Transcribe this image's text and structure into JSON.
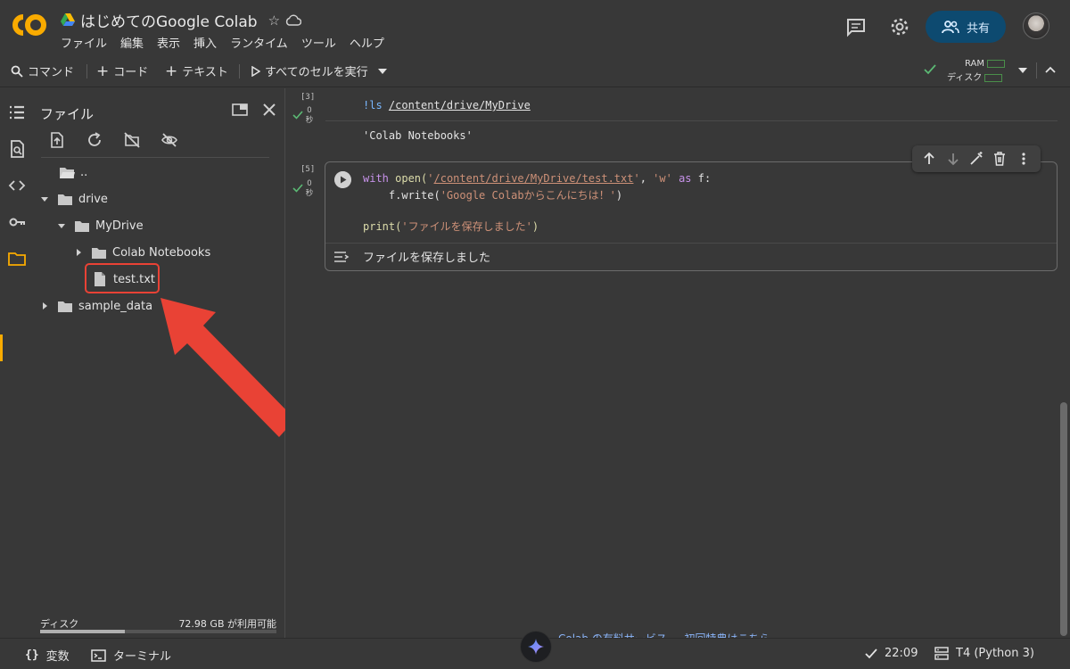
{
  "header": {
    "title": "はじめてのGoogle Colab",
    "menu": [
      "ファイル",
      "編集",
      "表示",
      "挿入",
      "ランタイム",
      "ツール",
      "ヘルプ"
    ],
    "share_label": "共有"
  },
  "toolbar": {
    "command": "コマンド",
    "add_code": "コード",
    "add_text": "テキスト",
    "run_all": "すべてのセルを実行",
    "ram_label": "RAM",
    "disk_label": "ディスク"
  },
  "file_panel": {
    "title": "ファイル",
    "tree": [
      {
        "label": "..",
        "type": "parent"
      },
      {
        "label": "drive",
        "type": "folder",
        "expanded": true
      },
      {
        "label": "MyDrive",
        "type": "folder",
        "expanded": true
      },
      {
        "label": "Colab Notebooks",
        "type": "folder",
        "expanded": false
      },
      {
        "label": "test.txt",
        "type": "file",
        "highlighted": true
      },
      {
        "label": "sample_data",
        "type": "folder",
        "expanded": false
      }
    ],
    "disk_label": "ディスク",
    "disk_free": "72.98 GB が利用可能",
    "disk_usage_fraction": 0.36
  },
  "cells": [
    {
      "exec_count": "[3]",
      "time_value": "0",
      "time_unit": "秒",
      "code_bang": "!ls ",
      "code_path": "/content/drive/MyDrive",
      "output": "'Colab Notebooks'"
    },
    {
      "exec_count": "[5]",
      "time_value": "0",
      "time_unit": "秒",
      "line1_kw": "with",
      "line1_fn": " open(",
      "line1_q1": "'",
      "line1_path": "/content/drive/MyDrive/test.txt",
      "line1_q2": "'",
      "line1_mid": ", ",
      "line1_mode": "'w'",
      "line1_as": " as ",
      "line1_var": "f:",
      "line2_indent": "    ",
      "line2_call": "f.write(",
      "line2_str": "'Google Colabからこんにちは！'",
      "line2_close": ")",
      "line3_fn": "print(",
      "line3_str": "'ファイルを保存しました'",
      "line3_close": ")",
      "output": "ファイルを保存しました"
    }
  ],
  "statusbar": {
    "variables": "変数",
    "terminal": "ターミナル",
    "time": "22:09",
    "runtime": "T4 (Python 3)",
    "promo": "Colab の有料サービス — 初回特典はこちら"
  },
  "colors": {
    "accent_orange": "#f9ab00",
    "highlight_red": "#e94235",
    "share_blue": "#0d4a70"
  }
}
